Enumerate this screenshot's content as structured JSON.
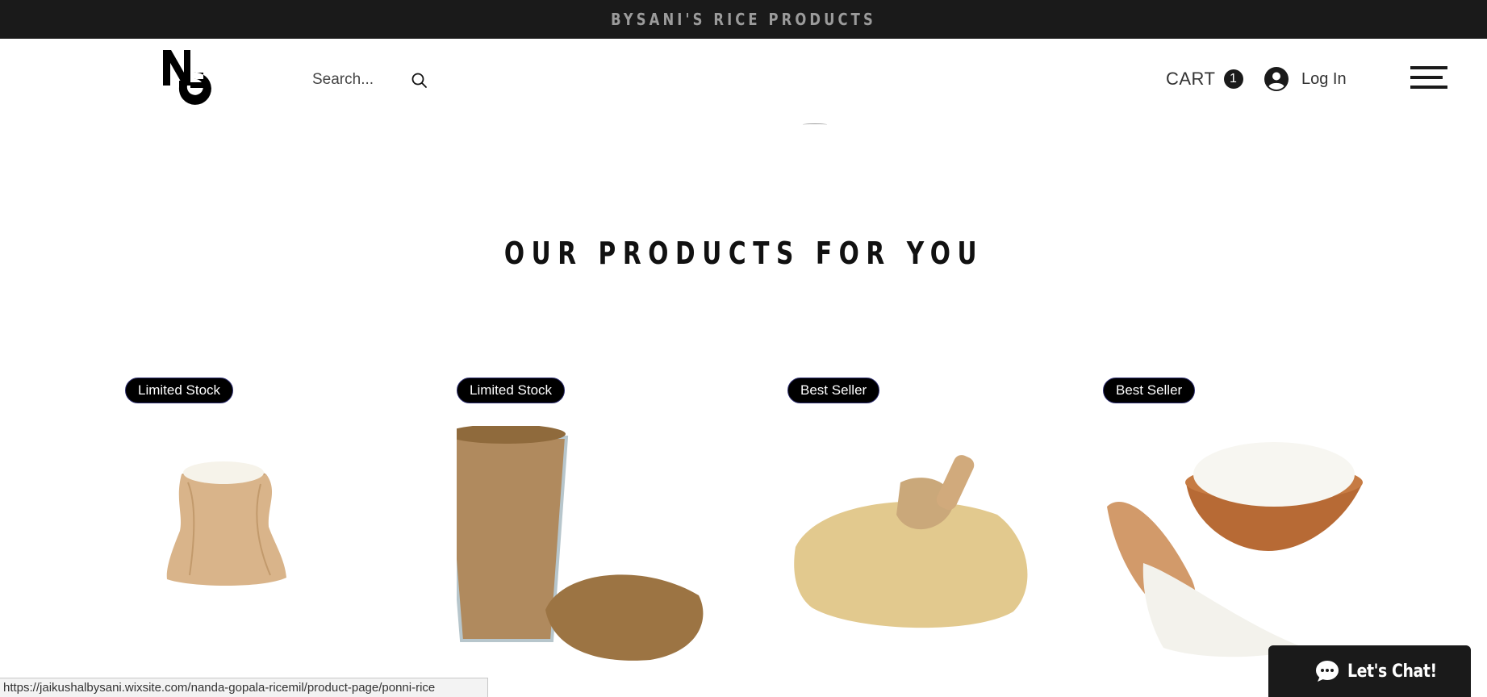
{
  "announcement": {
    "text": "BYSANI'S RICE PRODUCTS"
  },
  "header": {
    "logo_letters": "NG",
    "search": {
      "placeholder": "Search..."
    },
    "cart": {
      "label": "CART",
      "count": "1"
    },
    "login": {
      "label": "Log In"
    }
  },
  "section": {
    "title": "OUR PRODUCTS FOR YOU"
  },
  "products": [
    {
      "badge": "Limited Stock",
      "image": "rice-sack"
    },
    {
      "badge": "Limited Stock",
      "image": "brown-rice-glass"
    },
    {
      "badge": "Best Seller",
      "image": "broken-rice-scoop"
    },
    {
      "badge": "Best Seller",
      "image": "basmati-rice-bowl"
    }
  ],
  "chat": {
    "label": "Let's Chat!"
  },
  "status_bar": {
    "url": "https://jaikushalbysani.wixsite.com/nanda-gopala-ricemil/product-page/ponni-rice"
  },
  "colors": {
    "bar": "#1a1a1a",
    "badge_bg": "#000000",
    "badge_border": "#2a2a6b",
    "announce_text": "#9b9b9b"
  }
}
